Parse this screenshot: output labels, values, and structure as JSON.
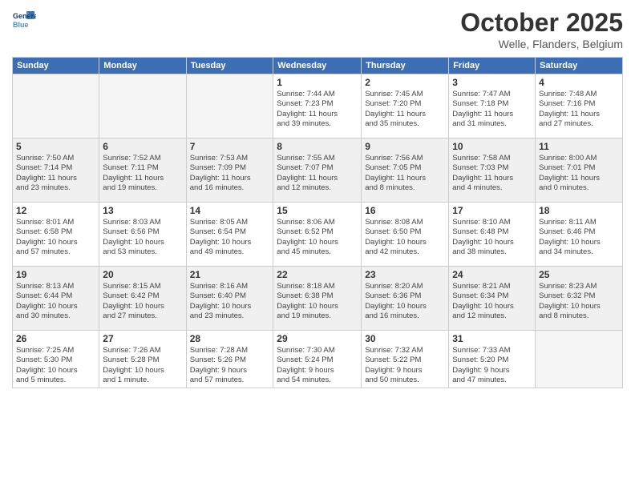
{
  "logo": {
    "line1": "General",
    "line2": "Blue"
  },
  "header": {
    "month": "October 2025",
    "location": "Welle, Flanders, Belgium"
  },
  "weekdays": [
    "Sunday",
    "Monday",
    "Tuesday",
    "Wednesday",
    "Thursday",
    "Friday",
    "Saturday"
  ],
  "weeks": [
    [
      {
        "day": "",
        "info": ""
      },
      {
        "day": "",
        "info": ""
      },
      {
        "day": "",
        "info": ""
      },
      {
        "day": "1",
        "info": "Sunrise: 7:44 AM\nSunset: 7:23 PM\nDaylight: 11 hours\nand 39 minutes."
      },
      {
        "day": "2",
        "info": "Sunrise: 7:45 AM\nSunset: 7:20 PM\nDaylight: 11 hours\nand 35 minutes."
      },
      {
        "day": "3",
        "info": "Sunrise: 7:47 AM\nSunset: 7:18 PM\nDaylight: 11 hours\nand 31 minutes."
      },
      {
        "day": "4",
        "info": "Sunrise: 7:48 AM\nSunset: 7:16 PM\nDaylight: 11 hours\nand 27 minutes."
      }
    ],
    [
      {
        "day": "5",
        "info": "Sunrise: 7:50 AM\nSunset: 7:14 PM\nDaylight: 11 hours\nand 23 minutes."
      },
      {
        "day": "6",
        "info": "Sunrise: 7:52 AM\nSunset: 7:11 PM\nDaylight: 11 hours\nand 19 minutes."
      },
      {
        "day": "7",
        "info": "Sunrise: 7:53 AM\nSunset: 7:09 PM\nDaylight: 11 hours\nand 16 minutes."
      },
      {
        "day": "8",
        "info": "Sunrise: 7:55 AM\nSunset: 7:07 PM\nDaylight: 11 hours\nand 12 minutes."
      },
      {
        "day": "9",
        "info": "Sunrise: 7:56 AM\nSunset: 7:05 PM\nDaylight: 11 hours\nand 8 minutes."
      },
      {
        "day": "10",
        "info": "Sunrise: 7:58 AM\nSunset: 7:03 PM\nDaylight: 11 hours\nand 4 minutes."
      },
      {
        "day": "11",
        "info": "Sunrise: 8:00 AM\nSunset: 7:01 PM\nDaylight: 11 hours\nand 0 minutes."
      }
    ],
    [
      {
        "day": "12",
        "info": "Sunrise: 8:01 AM\nSunset: 6:58 PM\nDaylight: 10 hours\nand 57 minutes."
      },
      {
        "day": "13",
        "info": "Sunrise: 8:03 AM\nSunset: 6:56 PM\nDaylight: 10 hours\nand 53 minutes."
      },
      {
        "day": "14",
        "info": "Sunrise: 8:05 AM\nSunset: 6:54 PM\nDaylight: 10 hours\nand 49 minutes."
      },
      {
        "day": "15",
        "info": "Sunrise: 8:06 AM\nSunset: 6:52 PM\nDaylight: 10 hours\nand 45 minutes."
      },
      {
        "day": "16",
        "info": "Sunrise: 8:08 AM\nSunset: 6:50 PM\nDaylight: 10 hours\nand 42 minutes."
      },
      {
        "day": "17",
        "info": "Sunrise: 8:10 AM\nSunset: 6:48 PM\nDaylight: 10 hours\nand 38 minutes."
      },
      {
        "day": "18",
        "info": "Sunrise: 8:11 AM\nSunset: 6:46 PM\nDaylight: 10 hours\nand 34 minutes."
      }
    ],
    [
      {
        "day": "19",
        "info": "Sunrise: 8:13 AM\nSunset: 6:44 PM\nDaylight: 10 hours\nand 30 minutes."
      },
      {
        "day": "20",
        "info": "Sunrise: 8:15 AM\nSunset: 6:42 PM\nDaylight: 10 hours\nand 27 minutes."
      },
      {
        "day": "21",
        "info": "Sunrise: 8:16 AM\nSunset: 6:40 PM\nDaylight: 10 hours\nand 23 minutes."
      },
      {
        "day": "22",
        "info": "Sunrise: 8:18 AM\nSunset: 6:38 PM\nDaylight: 10 hours\nand 19 minutes."
      },
      {
        "day": "23",
        "info": "Sunrise: 8:20 AM\nSunset: 6:36 PM\nDaylight: 10 hours\nand 16 minutes."
      },
      {
        "day": "24",
        "info": "Sunrise: 8:21 AM\nSunset: 6:34 PM\nDaylight: 10 hours\nand 12 minutes."
      },
      {
        "day": "25",
        "info": "Sunrise: 8:23 AM\nSunset: 6:32 PM\nDaylight: 10 hours\nand 8 minutes."
      }
    ],
    [
      {
        "day": "26",
        "info": "Sunrise: 7:25 AM\nSunset: 5:30 PM\nDaylight: 10 hours\nand 5 minutes."
      },
      {
        "day": "27",
        "info": "Sunrise: 7:26 AM\nSunset: 5:28 PM\nDaylight: 10 hours\nand 1 minute."
      },
      {
        "day": "28",
        "info": "Sunrise: 7:28 AM\nSunset: 5:26 PM\nDaylight: 9 hours\nand 57 minutes."
      },
      {
        "day": "29",
        "info": "Sunrise: 7:30 AM\nSunset: 5:24 PM\nDaylight: 9 hours\nand 54 minutes."
      },
      {
        "day": "30",
        "info": "Sunrise: 7:32 AM\nSunset: 5:22 PM\nDaylight: 9 hours\nand 50 minutes."
      },
      {
        "day": "31",
        "info": "Sunrise: 7:33 AM\nSunset: 5:20 PM\nDaylight: 9 hours\nand 47 minutes."
      },
      {
        "day": "",
        "info": ""
      }
    ]
  ]
}
